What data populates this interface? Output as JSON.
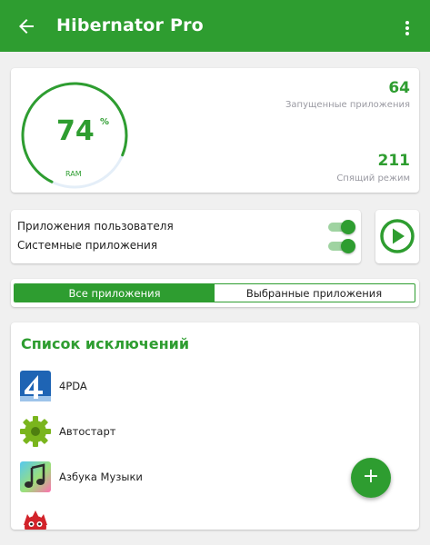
{
  "colors": {
    "accent": "#2e9d30",
    "accent_light": "#9fd3a1",
    "muted_text": "#9a9aa2"
  },
  "appbar": {
    "title": "Hibernator Pro",
    "back_icon": "arrow-left-icon",
    "menu_icon": "more-vertical-icon"
  },
  "ram": {
    "percent": "74",
    "percent_sign": "%",
    "percent_value": 74,
    "label": "RAM",
    "running_count": "64",
    "running_label": "Запущенные приложения",
    "sleeping_count": "211",
    "sleeping_label": "Спящий режим"
  },
  "toggles": [
    {
      "label": "Приложения пользователя",
      "on": true
    },
    {
      "label": "Системные приложения",
      "on": true
    }
  ],
  "play_button_icon": "play-circle-icon",
  "tabs": [
    {
      "label": "Все приложения",
      "selected": true
    },
    {
      "label": "Выбранные приложения",
      "selected": false
    }
  ],
  "exclusions": {
    "title": "Список исключений",
    "items": [
      {
        "name": "4PDA",
        "icon": "4pda-app-icon"
      },
      {
        "name": "Автостарт",
        "icon": "gear-app-icon"
      },
      {
        "name": "Азбука Музыки",
        "icon": "music-note-app-icon"
      }
    ]
  },
  "fab_label": "+"
}
